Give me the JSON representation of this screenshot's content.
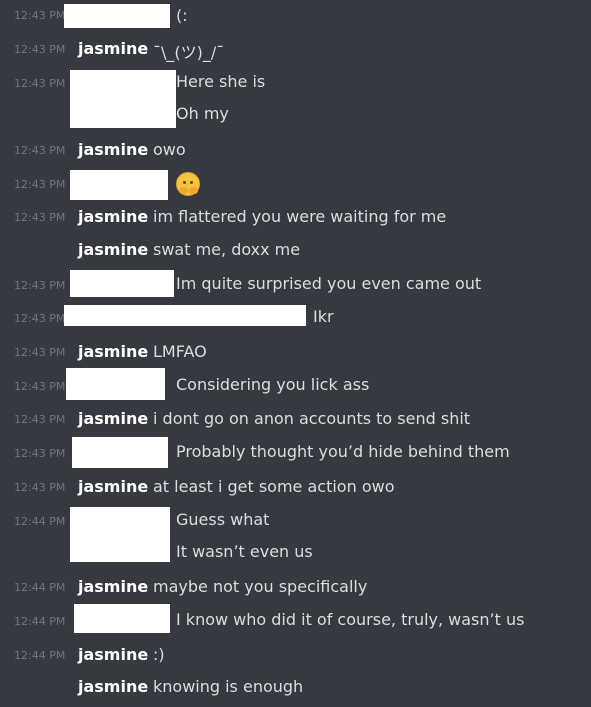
{
  "colors": {
    "background": "#36393f",
    "name": "#ffffff",
    "text": "#dcddde",
    "timestamp": "#72767d",
    "redaction": "#ffffff"
  },
  "messages": [
    {
      "time": "12:43 PM",
      "author": "",
      "text": "(:"
    },
    {
      "time": "12:43 PM",
      "author": "jasmine",
      "text": "¯\\_(ツ)_/¯"
    },
    {
      "time": "12:43 PM",
      "author": "",
      "text": "Here she is"
    },
    {
      "time": "",
      "author": "",
      "text": "Oh my"
    },
    {
      "time": "12:43 PM",
      "author": "jasmine",
      "text": "owo"
    },
    {
      "time": "12:43 PM",
      "author": "",
      "text": "",
      "icon": "hugging-face-emoji"
    },
    {
      "time": "12:43 PM",
      "author": "jasmine",
      "text": "im flattered you were waiting for me"
    },
    {
      "time": "",
      "author": "jasmine",
      "text": "swat me, doxx me"
    },
    {
      "time": "12:43 PM",
      "author": "",
      "text": "Im quite surprised you even came out"
    },
    {
      "time": "12:43 PM",
      "author": "",
      "text": "Ikr"
    },
    {
      "time": "12:43 PM",
      "author": "jasmine",
      "text": "LMFAO"
    },
    {
      "time": "12:43 PM",
      "author": "",
      "text": "Considering you lick ass"
    },
    {
      "time": "12:43 PM",
      "author": "jasmine",
      "text": "i dont go on anon accounts to send shit"
    },
    {
      "time": "12:43 PM",
      "author": "",
      "text": "Probably thought you’d hide behind them"
    },
    {
      "time": "12:43 PM",
      "author": "jasmine",
      "text": "at least i get some action owo"
    },
    {
      "time": "12:44 PM",
      "author": "",
      "text": "Guess what"
    },
    {
      "time": "",
      "author": "",
      "text": "It wasn’t even us"
    },
    {
      "time": "12:44 PM",
      "author": "jasmine",
      "text": "maybe not you specifically"
    },
    {
      "time": "12:44 PM",
      "author": "",
      "text": "I know who did it of course, truly, wasn’t us"
    },
    {
      "time": "12:44 PM",
      "author": "jasmine",
      "text": ":)"
    },
    {
      "time": "",
      "author": "jasmine",
      "text": "knowing is enough"
    }
  ]
}
